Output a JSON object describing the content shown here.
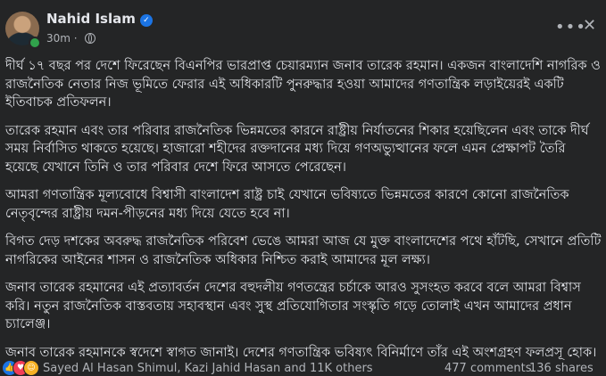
{
  "post": {
    "author": "Nahid Islam",
    "time": "30m",
    "verified_icon": "verified-badge-icon",
    "privacy_icon": "globe-icon",
    "more_label": "•••",
    "close_label": "✕",
    "paragraphs": [
      "দীর্ঘ ১৭ বছর পর দেশে ফিরেছেন বিএনপির ভারপ্রাপ্ত চেয়ারম্যান জনাব তারেক রহমান। একজন বাংলাদেশি নাগরিক ও রাজনৈতিক নেতার নিজ ভূমিতে ফেরার এই অধিকারটি পুনরুদ্ধার হওয়া আমাদের গণতান্ত্রিক লড়াইয়েরই একটি ইতিবাচক প্রতিফলন।",
      "তারেক রহমান এবং তার পরিবার রাজনৈতিক ভিন্নমতের কারনে রাষ্ট্রীয় নির্যাতনের শিকার হয়েছিলেন এবং তাকে দীর্ঘ সময় নির্বাসিত থাকতে হয়েছে। হাজারো শহীদের রক্তদানের মধ্য দিয়ে গণঅভ্যুত্থানের ফলে এমন প্রেক্ষাপট তৈরি হয়েছে যেখানে তিনি ও তার পরিবার দেশে ফিরে আসতে পেরেছেন।",
      "আমরা গণতান্ত্রিক মূল্যবোধে বিশ্বাসী বাংলাদেশ রাষ্ট্র চাই যেখানে ভবিষ্যতে ভিন্নমতের কারণে কোনো রাজনৈতিক নেতৃবৃন্দের রাষ্ট্রীয় দমন-পীড়নের মধ্য দিয়ে যেতে হবে না।",
      "বিগত দেড় দশকের অবরুদ্ধ রাজনৈতিক পরিবেশ ভেঙে আমরা আজ যে মুক্ত বাংলাদেশের পথে হাঁটছি, সেখানে প্রতিটি নাগরিকের আইনের শাসন ও রাজনৈতিক অধিকার নিশ্চিত করাই আমাদের মূল লক্ষ্য।",
      "জনাব তারেক রহমানের এই প্রত্যাবর্তন দেশের বহুদলীয় গণতন্ত্রের চর্চাকে আরও সুসংহত করবে বলে আমরা বিশ্বাস করি। নতুন রাজনৈতিক বাস্তবতায় সহাবস্থান এবং সুস্থ প্রতিযোগিতার সংস্কৃতি গড়ে তোলাই এখন আমাদের প্রধান চ্যালেঞ্জ।",
      "জনাব তারেক রহমানকে স্বদেশে স্বাগত জানাই। দেশের গণতান্ত্রিক ভবিষ্যৎ বিনির্মাণে তাঁর এই অংশগ্রহণ ফলপ্রসূ হোক।"
    ]
  },
  "footer": {
    "reaction_icons": [
      "like-icon",
      "love-icon",
      "care-icon"
    ],
    "likers": "Sayed Al Hasan Shimul, Kazi Jahid Hasan and 11K others",
    "comments": "477 comments",
    "shares": "136 shares"
  }
}
